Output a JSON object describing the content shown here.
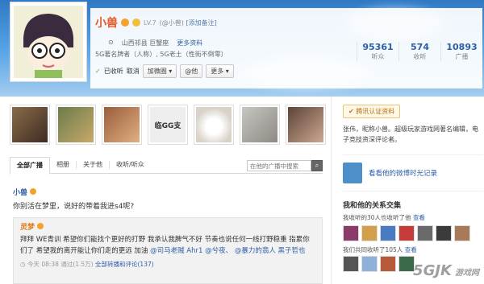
{
  "profile": {
    "name": "小兽",
    "level": "LV.7",
    "handle_prefix": "(@",
    "handle": "小兽",
    "handle_suffix": ")",
    "add_note": "[添加备注]",
    "location": "山西祁县 巨蟹座",
    "more_info": "更多资料",
    "tags": "5G著名牌者（人称）, 5G老土（性街不倒零）",
    "followed_label": "已收听",
    "unfollow": "取消",
    "add_group": "加微圈",
    "mention": "@他",
    "more": "更多"
  },
  "stats": [
    {
      "number": "95361",
      "label": "听众"
    },
    {
      "number": "574",
      "label": "收听"
    },
    {
      "number": "10893",
      "label": "广播"
    }
  ],
  "photos": [
    {
      "caption": ""
    },
    {
      "caption": ""
    },
    {
      "caption": ""
    },
    {
      "caption": "临GG支"
    },
    {
      "caption": ""
    },
    {
      "caption": ""
    },
    {
      "caption": ""
    }
  ],
  "tabs": [
    {
      "label": "全部广播"
    },
    {
      "label": "相册"
    },
    {
      "label": "关于他"
    },
    {
      "label": "收听/听众"
    }
  ],
  "search": {
    "placeholder": "在他的广播中搜索"
  },
  "post": {
    "author": "小兽",
    "text": "你别活在梦里，说好的带着我进s4呢?"
  },
  "quoted": {
    "author": "灵梦",
    "text_plain": "拜拜 WE青训 希望你们能找个更好的打野 我承认我脾气不好 节奏也说任何一线打野稳重 指累你们了 希望我的离开能让你们走的更远 加油 ",
    "mentions": "@司马老贼 Ahr1 @兮夜、 @暴力的翡人 黑子哲也",
    "time": "今天 08:38 通过(1.5万)",
    "comments": "全部转播和评论(137)"
  },
  "side": {
    "cert": "腾讯认证资料",
    "bio": "张伟，昵称小兽。超级玩家游戏网著名编辑，电子竞技资深评论者。",
    "timeline": "看看他的微博时光记录",
    "rel_title": "我和他的关系交集",
    "rel_sub1_prefix": "我收听的30人也收听了他",
    "rel_sub1_link": "查看",
    "rel_sub2_prefix": "我们共同收听了105人",
    "rel_sub2_link": "查看"
  },
  "watermark": {
    "brand": "5GJK",
    "text": "游戏网"
  }
}
